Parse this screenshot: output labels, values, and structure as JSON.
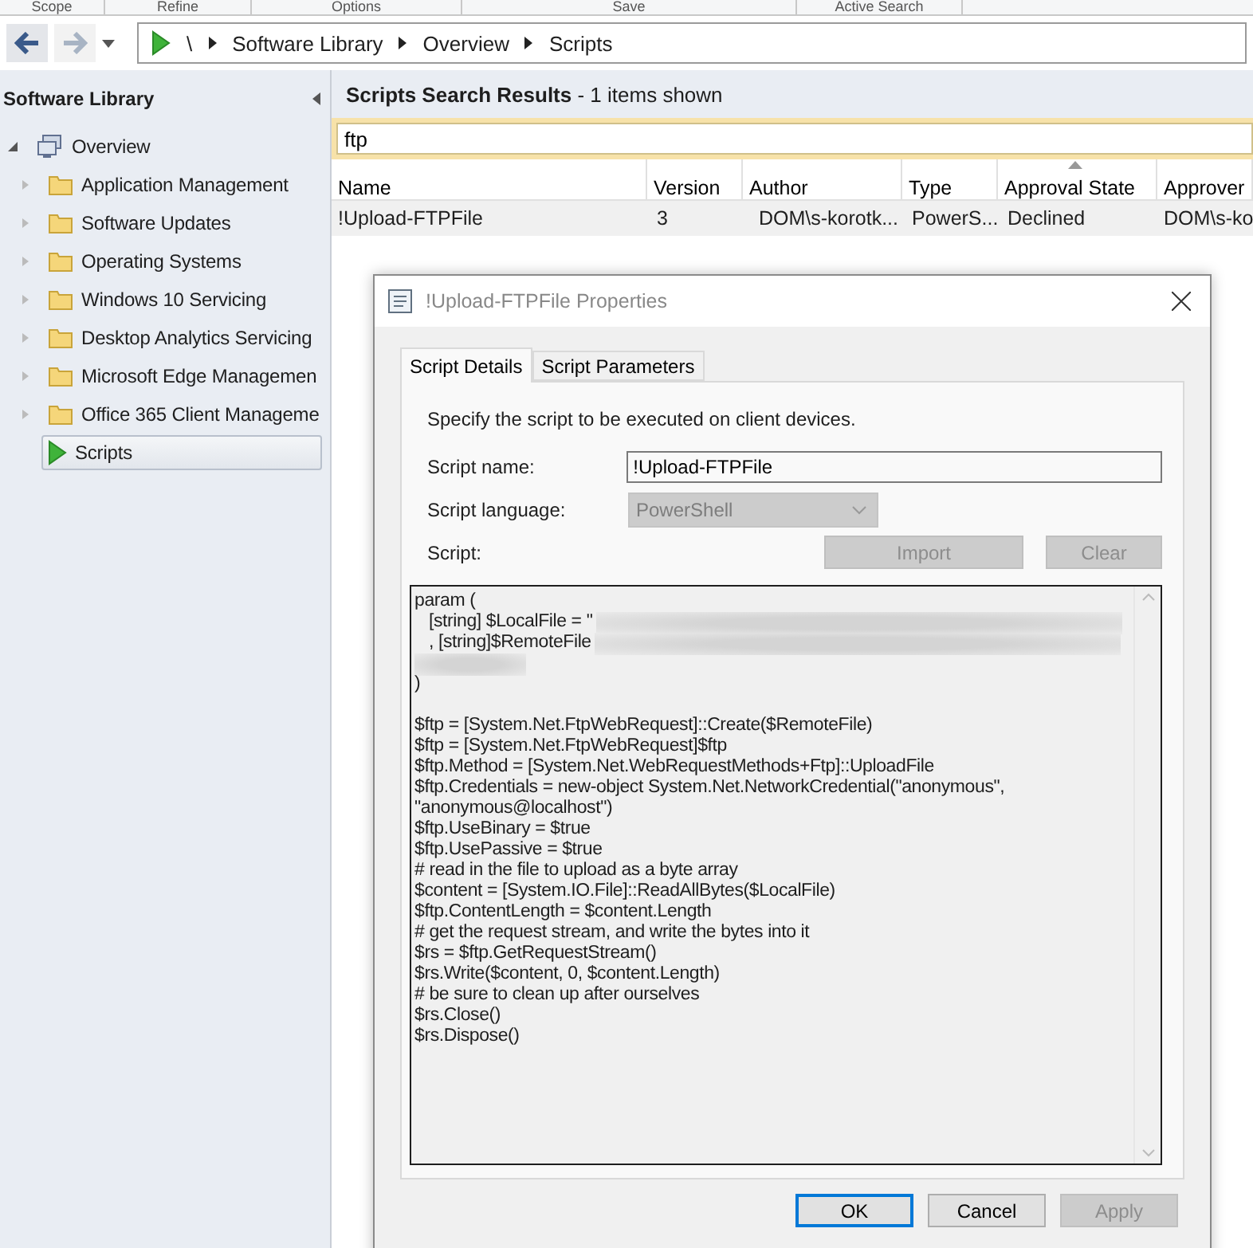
{
  "ribbon_groups": [
    "Scope",
    "Refine",
    "Options",
    "Save",
    "Active Search"
  ],
  "breadcrumb": [
    "\\",
    "Software Library",
    "Overview",
    "Scripts"
  ],
  "sidebar": {
    "title": "Software Library",
    "items": [
      {
        "label": "Overview",
        "kind": "overview",
        "expanded": true,
        "selected": false,
        "children": [
          {
            "label": "Application Management",
            "kind": "folder",
            "expanded": false,
            "selected": false
          },
          {
            "label": "Software Updates",
            "kind": "folder",
            "expanded": false,
            "selected": false
          },
          {
            "label": "Operating Systems",
            "kind": "folder",
            "expanded": false,
            "selected": false
          },
          {
            "label": "Windows 10 Servicing",
            "kind": "folder",
            "expanded": false,
            "selected": false
          },
          {
            "label": "Desktop Analytics Servicing",
            "kind": "folder",
            "expanded": false,
            "selected": false
          },
          {
            "label": "Microsoft Edge Managemen",
            "kind": "folder",
            "expanded": false,
            "selected": false
          },
          {
            "label": "Office 365 Client Manageme",
            "kind": "folder",
            "expanded": false,
            "selected": false
          },
          {
            "label": "Scripts",
            "kind": "scripts",
            "selected": true
          }
        ]
      }
    ]
  },
  "results": {
    "title": "**Scripts Search Results**  -  1 items shown",
    "search": {
      "value": "ftp"
    },
    "columns": [
      {
        "label": "Name",
        "sorted": false
      },
      {
        "label": "Version",
        "sorted": false
      },
      {
        "label": "Author",
        "sorted": false
      },
      {
        "label": "Type",
        "sorted": false
      },
      {
        "label": "Approval State",
        "sorted": true
      },
      {
        "label": "Approver",
        "sorted": false
      }
    ],
    "rows": [
      {
        "cells": [
          "!Upload-FTPFile",
          "3",
          "DOM\\s-korotk...",
          "PowerS...",
          "Declined",
          "DOM\\s-ko"
        ]
      }
    ]
  },
  "dialog": {
    "title": "!Upload-FTPFile Properties",
    "tabs": [
      {
        "label": "Script Details",
        "selected": true
      },
      {
        "label": "Script Parameters",
        "selected": false
      }
    ],
    "description": "Specify the script to be executed on client devices.",
    "name_label": "Script name:",
    "name_value": "!Upload-FTPFile",
    "language_label": "Script language:",
    "language_value": "PowerShell",
    "language_disabled": true,
    "script_label": "Script:",
    "script_buttons": [
      {
        "label": "Import",
        "disabled": true
      },
      {
        "label": "Clear",
        "disabled": true
      }
    ],
    "script_lines": [
      {
        "kind": "code",
        "text": "param (",
        "blurred": false
      },
      {
        "kind": "code",
        "text": "   [string] $LocalFile = \"",
        "blurred": true
      },
      {
        "kind": "code",
        "text": "   , [string]$RemoteFile",
        "blurred": true
      },
      {
        "kind": "blurred"
      },
      {
        "kind": "code",
        "text": ")",
        "blurred": false
      },
      {
        "kind": "blank"
      },
      {
        "kind": "code",
        "text": "$ftp = [System.Net.FtpWebRequest]::Create($RemoteFile)",
        "blurred": false
      },
      {
        "kind": "code",
        "text": "$ftp = [System.Net.FtpWebRequest]$ftp",
        "blurred": false
      },
      {
        "kind": "code",
        "text": "$ftp.Method = [System.Net.WebRequestMethods+Ftp]::UploadFile",
        "blurred": false
      },
      {
        "kind": "code",
        "text": "$ftp.Credentials = new-object System.Net.NetworkCredential(\"anonymous\",",
        "blurred": false
      },
      {
        "kind": "code",
        "text": "\"anonymous@localhost\")",
        "blurred": false
      },
      {
        "kind": "code",
        "text": "$ftp.UseBinary = $true",
        "blurred": false
      },
      {
        "kind": "code",
        "text": "$ftp.UsePassive = $true",
        "blurred": false
      },
      {
        "kind": "code",
        "text": "# read in the file to upload as a byte array",
        "blurred": false
      },
      {
        "kind": "code",
        "text": "$content = [System.IO.File]::ReadAllBytes($LocalFile)",
        "blurred": false
      },
      {
        "kind": "code",
        "text": "$ftp.ContentLength = $content.Length",
        "blurred": false
      },
      {
        "kind": "code",
        "text": "# get the request stream, and write the bytes into it",
        "blurred": false
      },
      {
        "kind": "code",
        "text": "$rs = $ftp.GetRequestStream()",
        "blurred": false
      },
      {
        "kind": "code",
        "text": "$rs.Write($content, 0, $content.Length)",
        "blurred": false
      },
      {
        "kind": "code",
        "text": "# be sure to clean up after ourselves",
        "blurred": false
      },
      {
        "kind": "code",
        "text": "$rs.Close()",
        "blurred": false
      },
      {
        "kind": "code",
        "text": "$rs.Dispose()",
        "blurred": false
      }
    ],
    "buttons": [
      {
        "label": "OK",
        "default": true,
        "disabled": false
      },
      {
        "label": "Cancel",
        "default": false,
        "disabled": false
      },
      {
        "label": "Apply",
        "default": false,
        "disabled": true
      }
    ]
  }
}
